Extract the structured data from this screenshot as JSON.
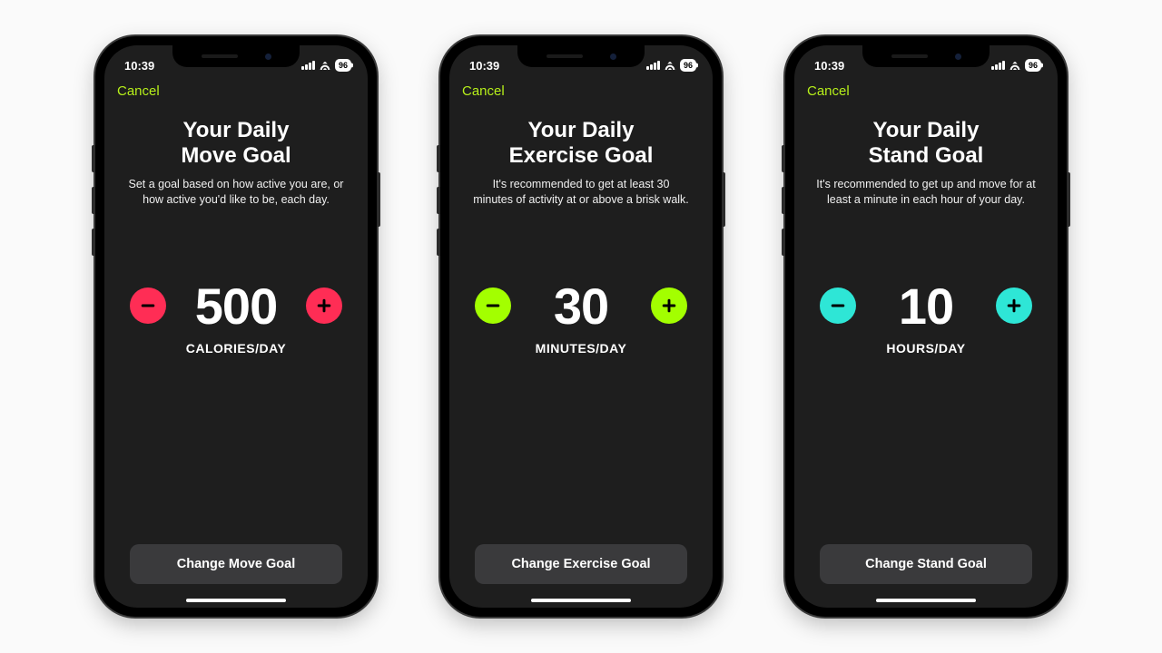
{
  "status": {
    "time": "10:39",
    "battery": "96"
  },
  "phones": [
    {
      "cancel": "Cancel",
      "title": "Your Daily\nMove Goal",
      "subtitle": "Set a goal based on how active you are, or how active you'd like to be, each day.",
      "value": "500",
      "unit": "CALORIES/DAY",
      "cta": "Change Move Goal",
      "accent": "#ff2d55",
      "accentClass": "accent-move"
    },
    {
      "cancel": "Cancel",
      "title": "Your Daily\nExercise Goal",
      "subtitle": "It's recommended to get at least 30 minutes of activity at or above a brisk walk.",
      "value": "30",
      "unit": "MINUTES/DAY",
      "cta": "Change Exercise Goal",
      "accent": "#a3ff00",
      "accentClass": "accent-exer"
    },
    {
      "cancel": "Cancel",
      "title": "Your Daily\nStand Goal",
      "subtitle": "It's recommended to get up and move for at least a minute in each hour of your day.",
      "value": "10",
      "unit": "HOURS/DAY",
      "cta": "Change Stand Goal",
      "accent": "#2ee6d6",
      "accentClass": "accent-stand"
    }
  ]
}
